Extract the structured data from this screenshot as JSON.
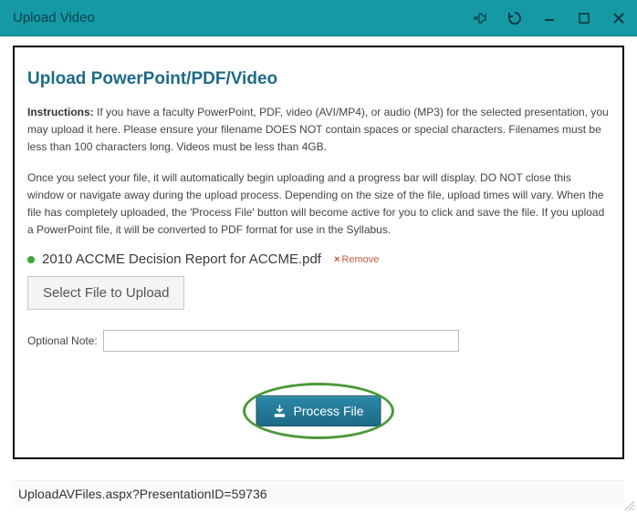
{
  "window": {
    "title": "Upload Video"
  },
  "panel": {
    "heading": "Upload PowerPoint/PDF/Video",
    "instructions_label": "Instructions:",
    "instructions_p1": " If you have a faculty PowerPoint, PDF, video (AVI/MP4), or audio (MP3) for the selected presentation, you may upload it here. Please ensure your filename DOES NOT contain spaces or special characters. Filenames must be less than 100 characters long. Videos must be less than 4GB.",
    "instructions_p2": "Once you select your file, it will automatically begin uploading and a progress bar will display. DO NOT close this window or navigate away during the upload process. Depending on the size of the file, upload times will vary. When the file has completely uploaded, the 'Process File' button will become active for you to click and save the file. If you upload a PowerPoint file, it will be converted to PDF format for use in the Syllabus.",
    "file": {
      "name": "2010 ACCME Decision Report for ACCME.pdf",
      "remove_label": "Remove"
    },
    "select_button": "Select File to Upload",
    "note_label": "Optional Note:",
    "note_value": "",
    "process_button": "Process File"
  },
  "statusbar": {
    "text": "UploadAVFiles.aspx?PresentationID=59736"
  }
}
